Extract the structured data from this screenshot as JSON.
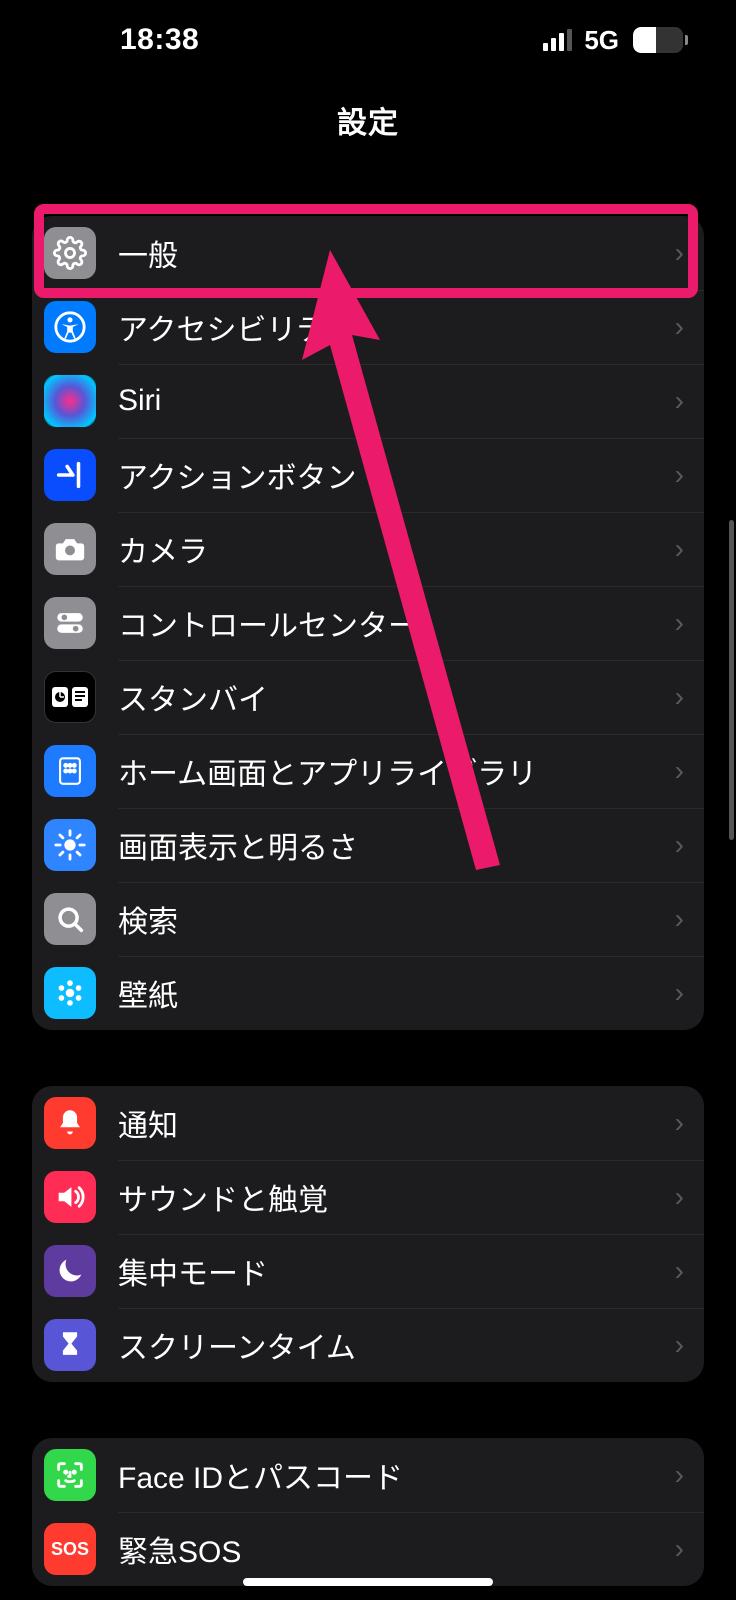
{
  "statusbar": {
    "time": "18:38",
    "network": "5G",
    "battery_pct": "45"
  },
  "navbar": {
    "title": "設定"
  },
  "groups": [
    {
      "rows": [
        {
          "label": "一般"
        },
        {
          "label": "アクセシビリテ"
        },
        {
          "label": "Siri"
        },
        {
          "label": "アクションボタン"
        },
        {
          "label": "カメラ"
        },
        {
          "label": "コントロールセンター"
        },
        {
          "label": "スタンバイ"
        },
        {
          "label": "ホーム画面とアプリライブラリ"
        },
        {
          "label": "画面表示と明るさ"
        },
        {
          "label": "検索"
        },
        {
          "label": "壁紙"
        }
      ]
    },
    {
      "rows": [
        {
          "label": "通知"
        },
        {
          "label": "サウンドと触覚"
        },
        {
          "label": "集中モード"
        },
        {
          "label": "スクリーンタイム"
        }
      ]
    },
    {
      "rows": [
        {
          "label": "Face IDとパスコード"
        },
        {
          "label": "緊急SOS"
        }
      ]
    }
  ],
  "sos_text": "SOS"
}
